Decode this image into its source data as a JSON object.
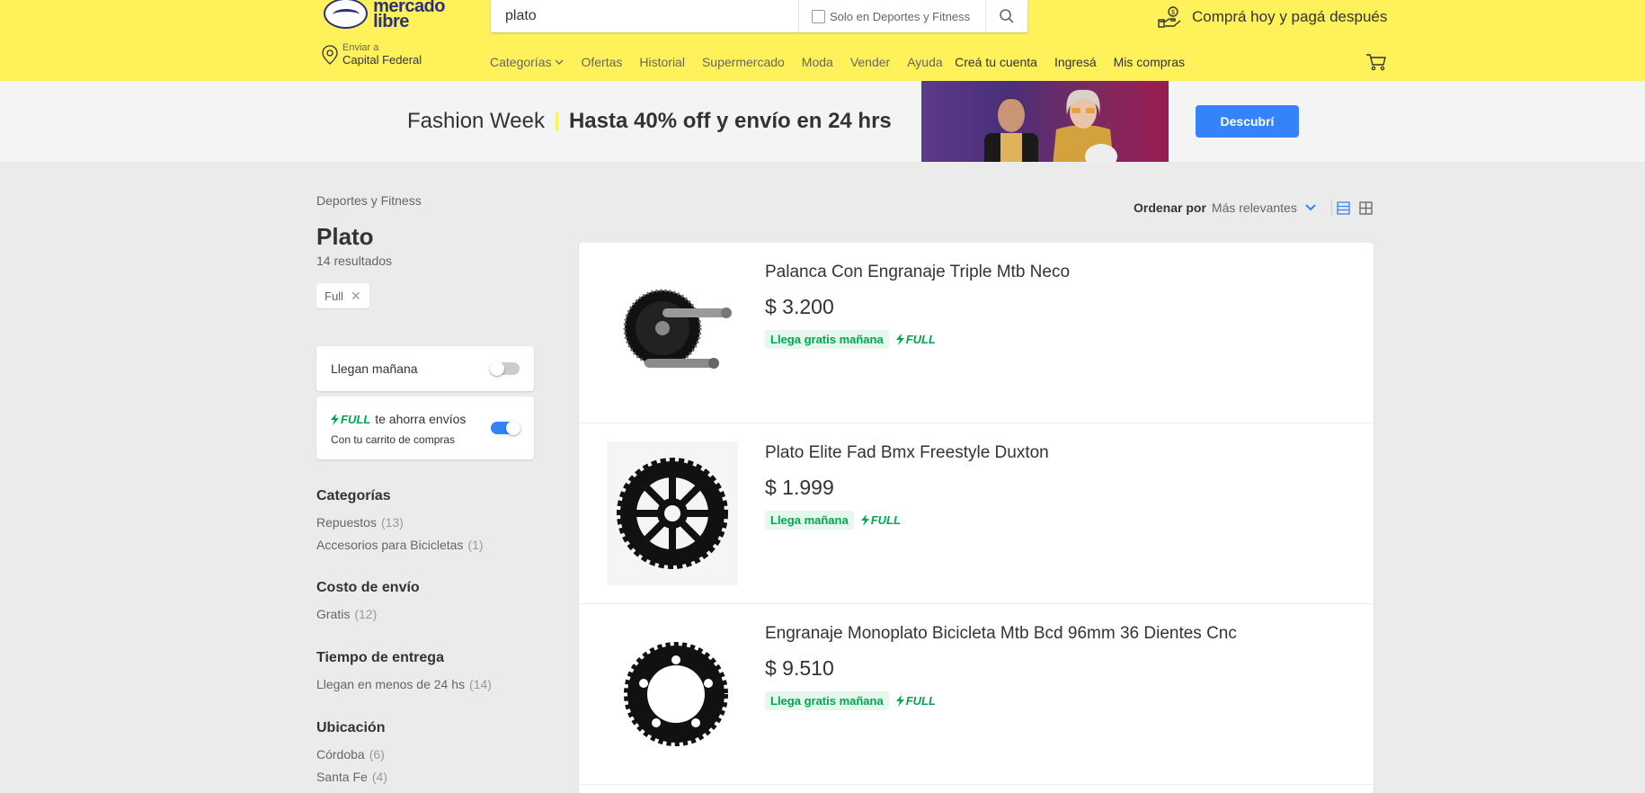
{
  "header": {
    "logo_line1": "mercado",
    "logo_line2": "libre",
    "search_value": "plato",
    "search_filter_label": "Solo en Deportes y Fitness",
    "promo": "Comprá hoy y pagá después",
    "location_small": "Enviar a",
    "location_big": "Capital Federal",
    "nav": [
      "Categorías",
      "Ofertas",
      "Historial",
      "Supermercado",
      "Moda",
      "Vender",
      "Ayuda"
    ],
    "nav_right": [
      "Creá tu cuenta",
      "Ingresá",
      "Mis compras"
    ],
    "brand_color": "#fff159"
  },
  "banner": {
    "text_light": "Fashion Week",
    "text_bold": "Hasta 40% off y envío en 24 hrs",
    "button": "Descubrí"
  },
  "sidebar": {
    "breadcrumb": "Deportes y Fitness",
    "title": "Plato",
    "results": "14 resultados",
    "chip": "Full",
    "llegan_label": "Llegan mañana",
    "llegan_on": false,
    "full_label": "FULL",
    "full_text": "te ahorra envíos",
    "full_sub": "Con tu carrito de compras",
    "full_on": true,
    "sections": [
      {
        "title": "Categorías",
        "items": [
          {
            "label": "Repuestos",
            "count": "(13)"
          },
          {
            "label": "Accesorios para Bicicletas",
            "count": "(1)"
          }
        ]
      },
      {
        "title": "Costo de envío",
        "items": [
          {
            "label": "Gratis",
            "count": "(12)"
          }
        ]
      },
      {
        "title": "Tiempo de entrega",
        "items": [
          {
            "label": "Llegan en menos de 24 hs",
            "count": "(14)"
          }
        ]
      },
      {
        "title": "Ubicación",
        "items": [
          {
            "label": "Córdoba",
            "count": "(6)"
          },
          {
            "label": "Santa Fe",
            "count": "(4)"
          }
        ]
      }
    ]
  },
  "sort": {
    "label": "Ordenar por",
    "value": "Más relevantes"
  },
  "items": [
    {
      "title": "Palanca Con Engranaje Triple Mtb Neco",
      "price": "$ 3.200",
      "shipping": "Llega gratis mañana",
      "full": "FULL",
      "image": "crankset"
    },
    {
      "title": "Plato Elite Fad Bmx Freestyle Duxton",
      "price": "$ 1.999",
      "shipping": "Llega mañana",
      "full": "FULL",
      "image": "bmx-sprocket"
    },
    {
      "title": "Engranaje Monoplato Bicicleta Mtb Bcd 96mm 36 Dientes Cnc",
      "price": "$ 9.510",
      "shipping": "Llega gratis mañana",
      "full": "FULL",
      "image": "chainring"
    }
  ],
  "accent_color": "#3483fa",
  "full_color": "#00a650"
}
